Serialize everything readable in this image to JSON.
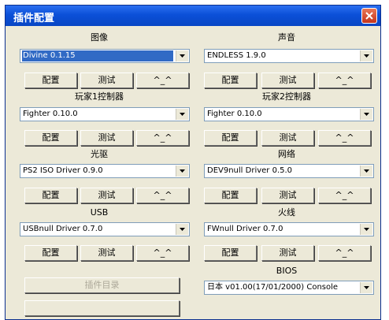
{
  "window": {
    "title": "插件配置"
  },
  "buttons": {
    "configure": "配置",
    "test": "测试",
    "about": "^_^"
  },
  "plugins": [
    {
      "label": "图像",
      "value": "Divine  0.1.15"
    },
    {
      "label": "声音",
      "value": "ENDLESS 1.9.0"
    },
    {
      "label": "玩家1控制器",
      "value": "Fighter 0.10.0"
    },
    {
      "label": "玩家2控制器",
      "value": "Fighter 0.10.0"
    },
    {
      "label": "光驱",
      "value": "PS2 ISO Driver 0.9.0"
    },
    {
      "label": "网络",
      "value": "DEV9null Driver 0.5.0"
    },
    {
      "label": "USB",
      "value": "USBnull Driver 0.7.0"
    },
    {
      "label": "火线",
      "value": "FWnull Driver 0.7.0"
    }
  ],
  "bios": {
    "label": "BIOS",
    "value": "日本  v01.00(17/01/2000) Console"
  },
  "plugin_dir_button": "插件目录",
  "colors": {
    "titlebar": "#0b50d8",
    "dialog": "#ece9d8",
    "selection": "#316ac5"
  }
}
